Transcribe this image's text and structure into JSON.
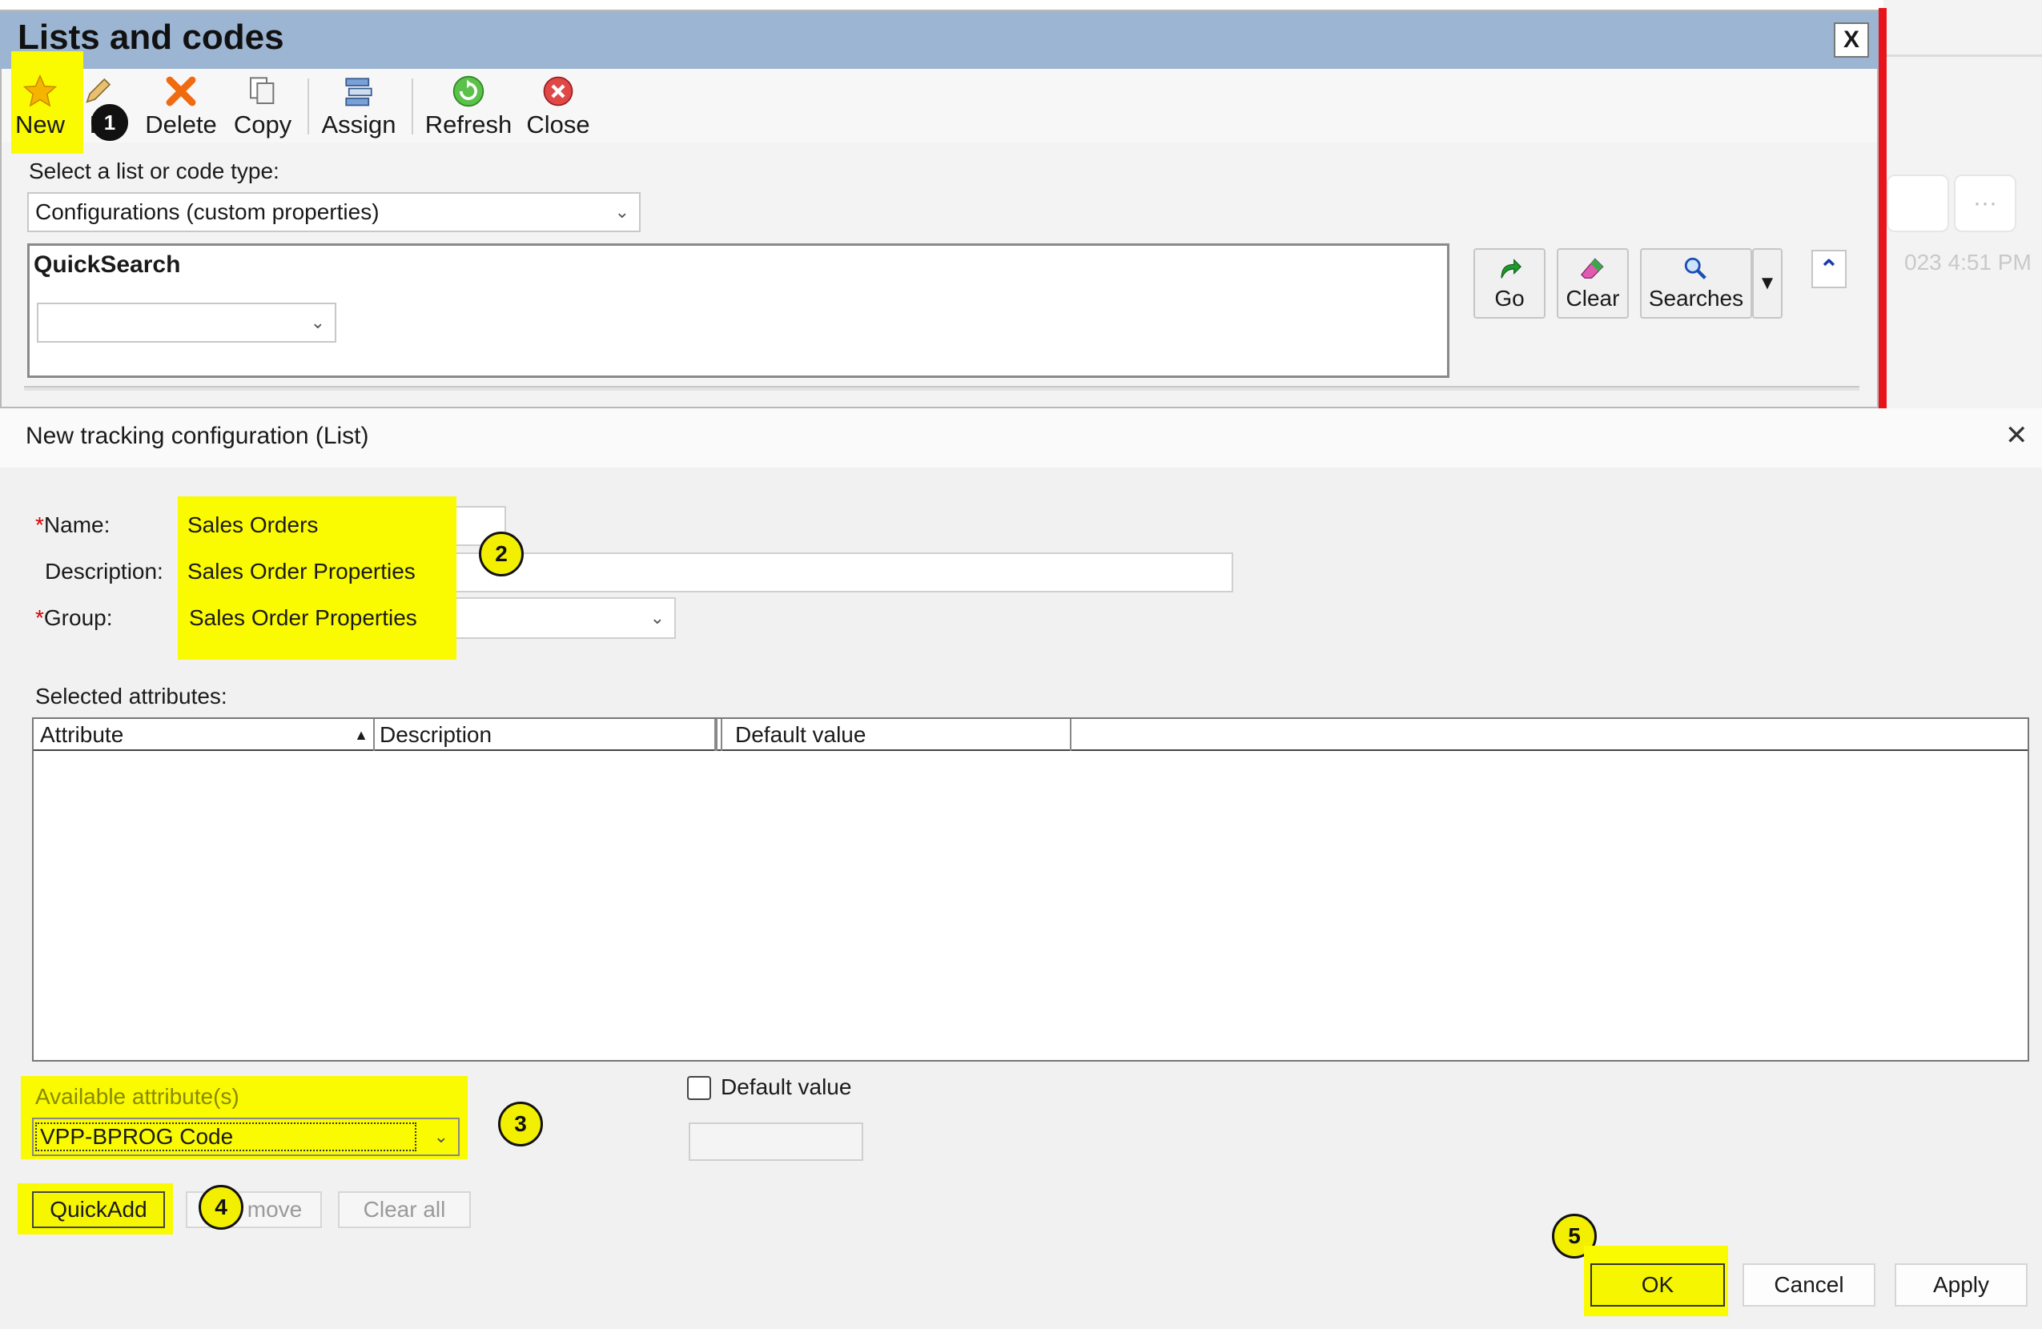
{
  "lists_window": {
    "title": "Lists and codes",
    "close_label": "X",
    "toolbar": {
      "new": "New",
      "edit": "E",
      "delete": "Delete",
      "copy": "Copy",
      "assign": "Assign",
      "refresh": "Refresh",
      "close": "Close"
    },
    "select_label": "Select a list or code type:",
    "select_value": "Configurations (custom properties)",
    "quicksearch_title": "QuickSearch",
    "quicksearch_value": "",
    "buttons": {
      "go": "Go",
      "clear": "Clear",
      "searches": "Searches"
    }
  },
  "background_window": {
    "text": "023 4:51 PM",
    "more": "···"
  },
  "dialog": {
    "title": "New tracking configuration (List)",
    "close_label": "✕",
    "required_marker": "*",
    "name_label": "Name:",
    "name_value": "Sales Orders",
    "description_label": "Description:",
    "description_value": "Sales Order Properties",
    "group_label": "Group:",
    "group_value": "Sales Order Properties",
    "selected_attributes_label": "Selected attributes:",
    "columns": [
      "Attribute",
      "Description",
      "Default value"
    ],
    "available_label": "Available attribute(s)",
    "available_value": "VPP-BPROG Code",
    "default_value_label": "Default value",
    "default_value_value": "",
    "quickadd_label": "QuickAdd",
    "remove_label": "Remove",
    "remove_visible": "move",
    "clear_all_label": "Clear all",
    "ok_label": "OK",
    "cancel_label": "Cancel",
    "apply_label": "Apply"
  },
  "callouts": [
    "1",
    "2",
    "3",
    "4",
    "5"
  ],
  "colors": {
    "highlight": "#fafa00",
    "title_bar": "#9bb5d3",
    "red_bar": "#e8141c",
    "callout": "#f2ef00"
  },
  "icons": {
    "new": "star-icon",
    "edit": "pencil-icon",
    "delete": "x-mark-icon",
    "copy": "copy-icon",
    "assign": "assign-icon",
    "refresh": "refresh-icon",
    "close": "close-circle-icon",
    "go": "arrow-go-icon",
    "clear": "eraser-icon",
    "searches": "search-icon"
  }
}
